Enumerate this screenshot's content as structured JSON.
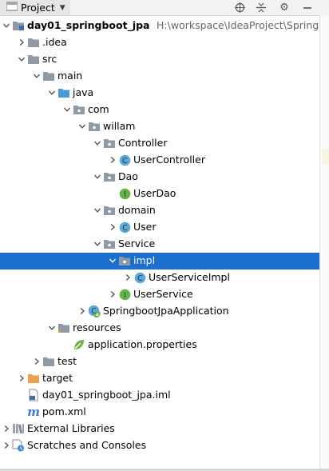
{
  "header": {
    "title": "Project",
    "caret_icon": "triangle-down-icon",
    "tools": [
      "crosshair-icon",
      "collapse-icon",
      "gear-icon",
      "minimize-icon"
    ]
  },
  "colors": {
    "selection": "#1a6fcf",
    "folder": "#8f9aa5",
    "source_folder": "#4a9ad9",
    "excluded_folder": "#f0a04b",
    "class_icon": "#5aa9d6",
    "interface_icon": "#62b543"
  },
  "tree": [
    {
      "label": "day01_springboot_jpa",
      "path": "H:\\workspace\\IdeaProject\\SpringBoot",
      "icon": "module-icon",
      "expanded": true,
      "bold": true
    },
    {
      "label": ".idea",
      "icon": "folder-icon",
      "expanded": false
    },
    {
      "label": "src",
      "icon": "folder-icon",
      "expanded": true
    },
    {
      "label": "main",
      "icon": "folder-icon",
      "expanded": true
    },
    {
      "label": "java",
      "icon": "source-folder-icon",
      "expanded": true
    },
    {
      "label": "com",
      "icon": "package-icon",
      "expanded": true
    },
    {
      "label": "willam",
      "icon": "package-icon",
      "expanded": true
    },
    {
      "label": "Controller",
      "icon": "package-icon",
      "expanded": true
    },
    {
      "label": "UserController",
      "icon": "class-icon",
      "expanded": false
    },
    {
      "label": "Dao",
      "icon": "package-icon",
      "expanded": true
    },
    {
      "label": "UserDao",
      "icon": "interface-icon"
    },
    {
      "label": "domain",
      "icon": "package-icon",
      "expanded": true
    },
    {
      "label": "User",
      "icon": "class-icon",
      "expanded": false
    },
    {
      "label": "Service",
      "icon": "package-icon",
      "expanded": true
    },
    {
      "label": "impl",
      "icon": "package-icon",
      "expanded": true,
      "selected": true
    },
    {
      "label": "UserServiceImpl",
      "icon": "class-icon",
      "expanded": false
    },
    {
      "label": "UserService",
      "icon": "interface-icon",
      "expanded": false
    },
    {
      "label": "SpringbootJpaApplication",
      "icon": "spring-boot-class-icon",
      "expanded": false
    },
    {
      "label": "resources",
      "icon": "resources-folder-icon",
      "expanded": true
    },
    {
      "label": "application.properties",
      "icon": "spring-properties-icon"
    },
    {
      "label": "test",
      "icon": "folder-icon",
      "expanded": false
    },
    {
      "label": "target",
      "icon": "excluded-folder-icon",
      "expanded": false
    },
    {
      "label": "day01_springboot_jpa.iml",
      "icon": "iml-file-icon"
    },
    {
      "label": "pom.xml",
      "icon": "maven-icon"
    },
    {
      "label": "External Libraries",
      "icon": "libraries-icon",
      "expanded": false
    },
    {
      "label": "Scratches and Consoles",
      "icon": "scratches-icon",
      "expanded": false
    }
  ]
}
